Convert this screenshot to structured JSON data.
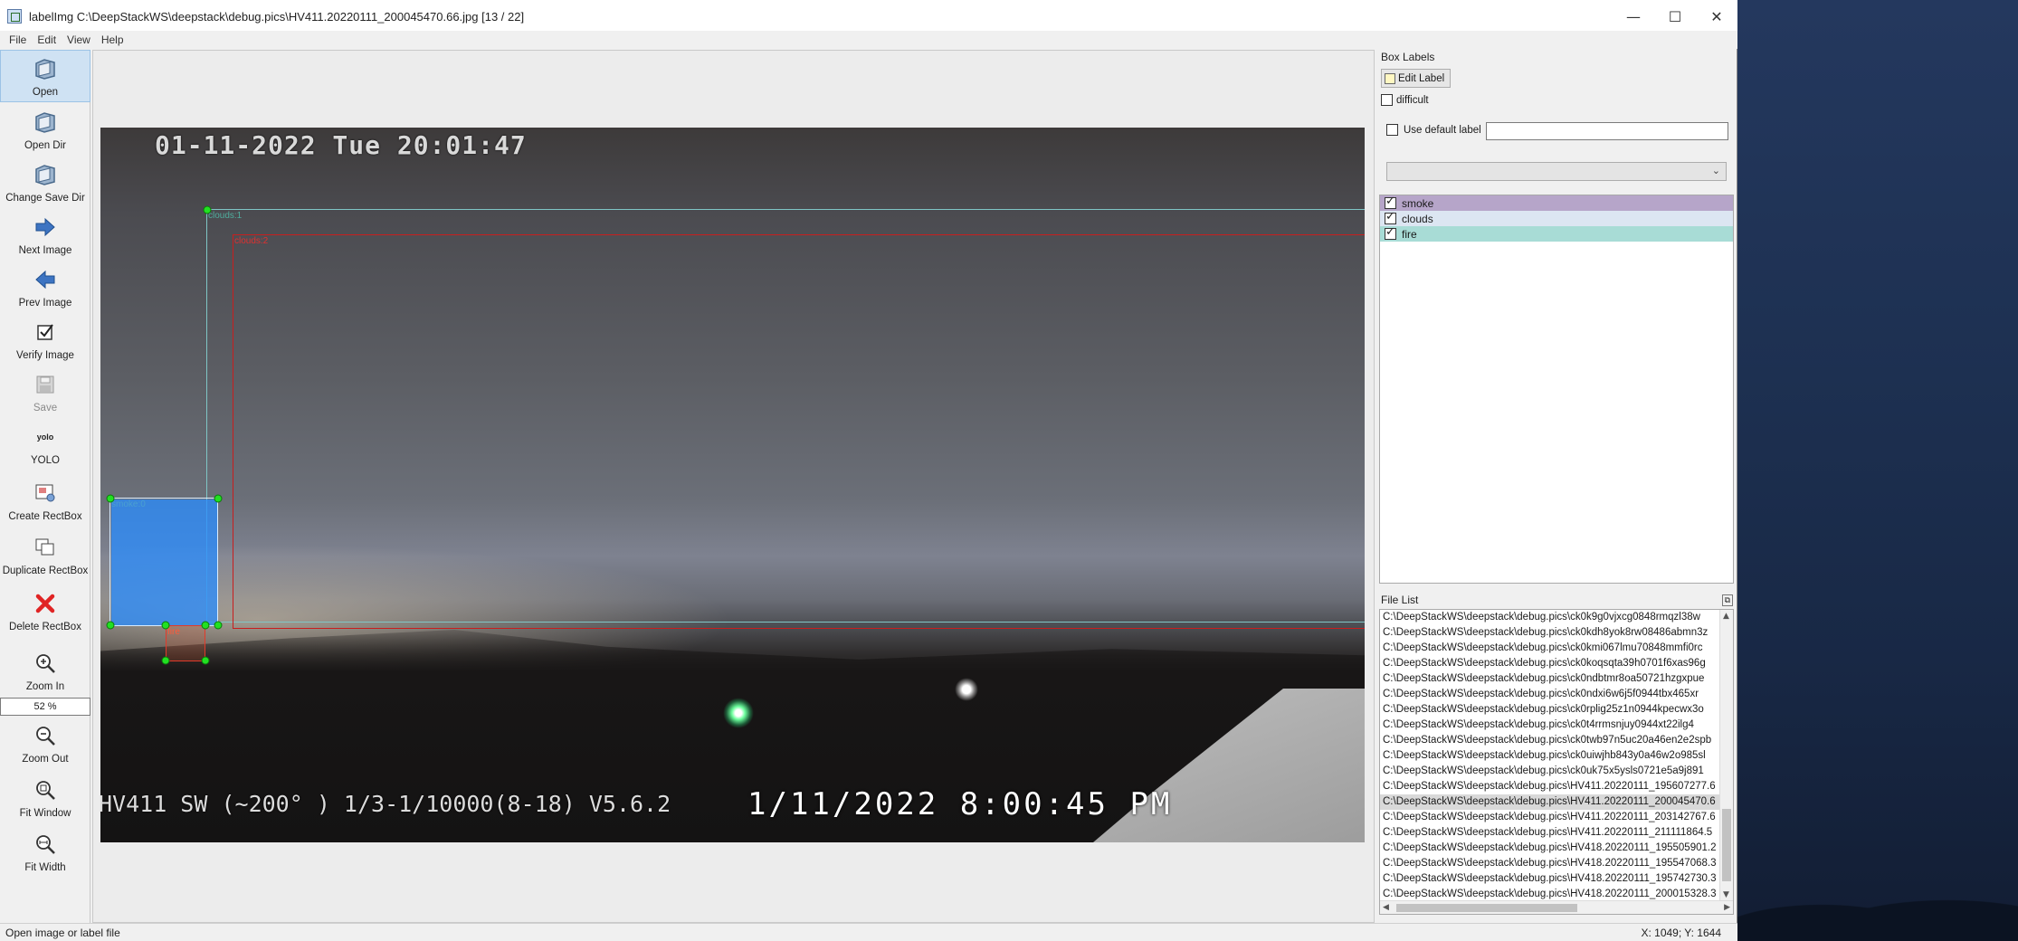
{
  "window": {
    "title": "labelImg C:\\DeepStackWS\\deepstack\\debug.pics\\HV411.20220111_200045470.66.jpg [13 / 22]",
    "minimize": "—",
    "maximize": "☐",
    "close": "✕"
  },
  "menu": {
    "file": "File",
    "edit": "Edit",
    "view": "View",
    "help": "Help"
  },
  "toolbar": {
    "open": "Open",
    "open_dir": "Open Dir",
    "change_save_dir": "Change Save Dir",
    "next_image": "Next Image",
    "prev_image": "Prev Image",
    "verify_image": "Verify Image",
    "save": "Save",
    "format_icon_text": "yolo",
    "format": "YOLO",
    "create_rectbox": "Create RectBox",
    "duplicate_rectbox": "Duplicate RectBox",
    "delete_rectbox": "Delete RectBox",
    "zoom_in": "Zoom In",
    "zoom_value": "52 %",
    "zoom_out": "Zoom Out",
    "fit_window": "Fit Window",
    "fit_width": "Fit Width"
  },
  "image": {
    "osd_top": "01-11-2022 Tue 20:01:47",
    "osd_bottom_left": "HV411 SW (~200° ) 1/3-1/10000(8-18) V5.6.2",
    "osd_bottom_right": "1/11/2022 8:00:45 PM"
  },
  "boxes": [
    {
      "label": "clouds:1",
      "color": "#7fc6c6"
    },
    {
      "label": "clouds:2",
      "color": "#c81e1e"
    },
    {
      "label": "smoke:0",
      "color": "#7fb0d8"
    },
    {
      "label": "fire",
      "color": "#e23a2a"
    }
  ],
  "box_labels_panel": {
    "title": "Box Labels",
    "edit_label": "Edit Label",
    "difficult": "difficult",
    "use_default_label": "Use default label",
    "default_label_value": "",
    "combo_value": "",
    "labels": [
      {
        "name": "smoke",
        "checked": true,
        "color": "#b6a5c9"
      },
      {
        "name": "clouds",
        "checked": true,
        "color": "#dce6f2"
      },
      {
        "name": "fire",
        "checked": true,
        "color": "#a8dcd6"
      }
    ]
  },
  "file_list_panel": {
    "title": "File List",
    "files": [
      "C:\\DeepStackWS\\deepstack\\debug.pics\\ck0k9g0vjxcg0848rmqzl38w",
      "C:\\DeepStackWS\\deepstack\\debug.pics\\ck0kdh8yok8rw08486abmn3z",
      "C:\\DeepStackWS\\deepstack\\debug.pics\\ck0kmi067lmu70848mmfi0rc",
      "C:\\DeepStackWS\\deepstack\\debug.pics\\ck0koqsqta39h0701f6xas96g",
      "C:\\DeepStackWS\\deepstack\\debug.pics\\ck0ndbtmr8oa50721hzgxpue",
      "C:\\DeepStackWS\\deepstack\\debug.pics\\ck0ndxi6w6j5f0944tbx465xr",
      "C:\\DeepStackWS\\deepstack\\debug.pics\\ck0rplig25z1n0944kpecwx3o",
      "C:\\DeepStackWS\\deepstack\\debug.pics\\ck0t4rrmsnjuy0944xt22ilg4",
      "C:\\DeepStackWS\\deepstack\\debug.pics\\ck0twb97n5uc20a46en2e2spb",
      "C:\\DeepStackWS\\deepstack\\debug.pics\\ck0uiwjhb843y0a46w2o985sl",
      "C:\\DeepStackWS\\deepstack\\debug.pics\\ck0uk75x5ysls0721e5a9j891",
      "C:\\DeepStackWS\\deepstack\\debug.pics\\HV411.20220111_195607277.6",
      "C:\\DeepStackWS\\deepstack\\debug.pics\\HV411.20220111_200045470.6",
      "C:\\DeepStackWS\\deepstack\\debug.pics\\HV411.20220111_203142767.6",
      "C:\\DeepStackWS\\deepstack\\debug.pics\\HV411.20220111_211111864.5",
      "C:\\DeepStackWS\\deepstack\\debug.pics\\HV418.20220111_195505901.2",
      "C:\\DeepStackWS\\deepstack\\debug.pics\\HV418.20220111_195547068.3",
      "C:\\DeepStackWS\\deepstack\\debug.pics\\HV418.20220111_195742730.3",
      "C:\\DeepStackWS\\deepstack\\debug.pics\\HV418.20220111_200015328.3"
    ],
    "selected_index": 12
  },
  "status": {
    "message": "Open image or label file",
    "coords": "X: 1049; Y: 1644"
  }
}
